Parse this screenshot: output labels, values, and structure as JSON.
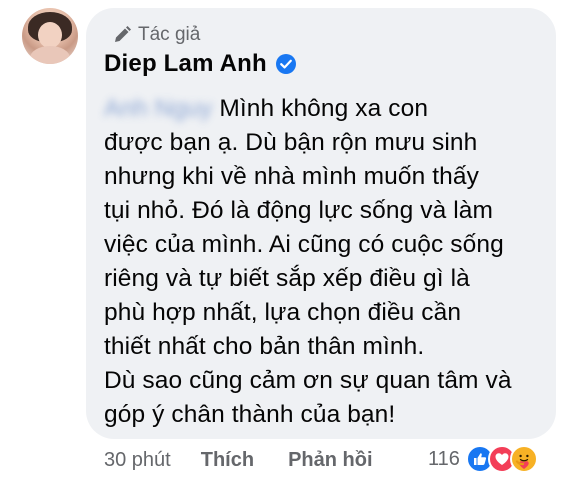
{
  "author_badge": "Tác giả",
  "author_name": "Diep Lam Anh",
  "comment": {
    "mention": "Anh Nguy",
    "lines": [
      "Mình không xa con",
      "được bạn ạ. Dù bận rộn mưu sinh",
      "nhưng khi về nhà mình muốn thấy",
      "tụi nhỏ. Đó là động lực sống và làm",
      "việc của mình. Ai cũng có cuộc sống",
      "riêng và tự biết sắp xếp điều gì là",
      "phù hợp nhất, lựa chọn điều cần",
      "thiết nhất cho bản thân mình.",
      "Dù sao cũng cảm ơn sự quan tâm và",
      "góp ý chân thành của bạn!"
    ]
  },
  "footer": {
    "time": "30 phút",
    "like_label": "Thích",
    "reply_label": "Phản hồi",
    "reaction_count": "116",
    "reactions": [
      "like",
      "love",
      "care"
    ]
  },
  "colors": {
    "bubble": "#eff1f4",
    "text": "#050505",
    "muted": "#65676b",
    "verified": "#1877f2"
  }
}
